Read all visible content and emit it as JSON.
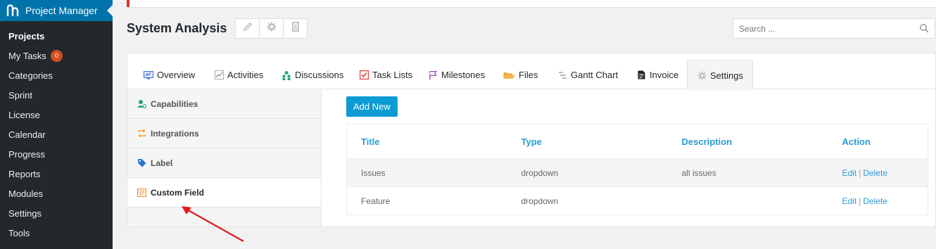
{
  "admin_menu": {
    "brand": "Project Manager",
    "items": [
      {
        "label": "Projects",
        "current": true
      },
      {
        "label": "My Tasks",
        "badge": "0"
      },
      {
        "label": "Categories"
      },
      {
        "label": "Sprint"
      },
      {
        "label": "License"
      },
      {
        "label": "Calendar"
      },
      {
        "label": "Progress"
      },
      {
        "label": "Reports"
      },
      {
        "label": "Modules"
      },
      {
        "label": "Settings"
      },
      {
        "label": "Tools"
      }
    ]
  },
  "header": {
    "project_title": "System Analysis",
    "actions": [
      "pencil-icon",
      "gear-icon",
      "document-icon"
    ],
    "search_placeholder": "Search ..."
  },
  "tabs": [
    {
      "label": "Overview",
      "icon": "overview-icon"
    },
    {
      "label": "Activities",
      "icon": "activities-icon"
    },
    {
      "label": "Discussions",
      "icon": "discussions-icon"
    },
    {
      "label": "Task Lists",
      "icon": "task-lists-icon"
    },
    {
      "label": "Milestones",
      "icon": "milestones-icon"
    },
    {
      "label": "Files",
      "icon": "files-icon"
    },
    {
      "label": "Gantt Chart",
      "icon": "gantt-chart-icon"
    },
    {
      "label": "Invoice",
      "icon": "invoice-icon"
    },
    {
      "label": "Settings",
      "icon": "settings-icon",
      "active": true
    }
  ],
  "settings_menu": [
    {
      "label": "Capabilities",
      "icon": "capabilities-icon"
    },
    {
      "label": "Integrations",
      "icon": "integrations-icon"
    },
    {
      "label": "Label",
      "icon": "label-icon"
    },
    {
      "label": "Custom Field",
      "icon": "custom-field-icon",
      "active": true
    }
  ],
  "custom_fields": {
    "add_button": "Add New",
    "columns": [
      "Title",
      "Type",
      "Description",
      "Action"
    ],
    "rows": [
      {
        "title": "Issues",
        "type": "dropdown",
        "description": "all issues",
        "edit": "Edit",
        "delete": "Delete"
      },
      {
        "title": "Feature",
        "type": "dropdown",
        "description": "",
        "edit": "Edit",
        "delete": "Delete"
      }
    ],
    "action_separator": "|"
  },
  "colors": {
    "sidebar_bg": "#23282d",
    "brand_bg": "#0073aa",
    "accent": "#0d9bd3",
    "link": "#2b9bd3",
    "badge": "#d54e21",
    "notice_border": "#dc3232",
    "annotation_arrow": "#e01b1b"
  }
}
